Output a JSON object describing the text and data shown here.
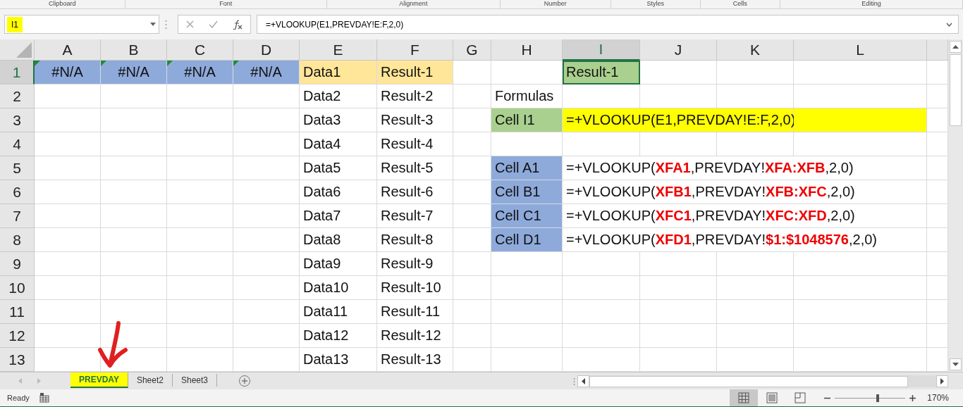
{
  "ribbon_groups": [
    "Clipboard",
    "Font",
    "Alignment",
    "Number",
    "Styles",
    "Cells",
    "Editing"
  ],
  "name_box": {
    "value": "I1",
    "highlighted": true
  },
  "formula_bar": {
    "value": "=+VLOOKUP(E1,PREVDAY!E:F,2,0)"
  },
  "columns": [
    {
      "label": "A",
      "selected": false
    },
    {
      "label": "B",
      "selected": false
    },
    {
      "label": "C",
      "selected": false
    },
    {
      "label": "D",
      "selected": false
    },
    {
      "label": "E",
      "selected": false
    },
    {
      "label": "F",
      "selected": false
    },
    {
      "label": "G",
      "selected": false
    },
    {
      "label": "H",
      "selected": false
    },
    {
      "label": "I",
      "selected": true
    },
    {
      "label": "J",
      "selected": false
    },
    {
      "label": "K",
      "selected": false
    },
    {
      "label": "L",
      "selected": false
    }
  ],
  "rows": [
    {
      "label": "1",
      "selected": true,
      "cells": [
        {
          "text": "#N/A",
          "color": "#8eaadb",
          "error_flag": true
        },
        {
          "text": "#N/A",
          "color": "#8eaadb",
          "error_flag": true
        },
        {
          "text": "#N/A",
          "color": "#8eaadb",
          "error_flag": true
        },
        {
          "text": "#N/A",
          "color": "#8eaadb",
          "error_flag": true
        },
        {
          "text": "Data1",
          "color": "#ffe699"
        },
        {
          "text": "Result-1",
          "color": "#ffe699"
        },
        {},
        {},
        {
          "text": "Result-1",
          "color": "#a9d08e",
          "selected": true
        }
      ]
    },
    {
      "label": "2",
      "selected": false,
      "cells": [
        {},
        {},
        {},
        {},
        {
          "text": "Data2"
        },
        {
          "text": "Result-2"
        },
        {},
        {
          "text": "Formulas"
        }
      ]
    },
    {
      "label": "3",
      "selected": false,
      "cells": [
        {},
        {},
        {},
        {},
        {
          "text": "Data3"
        },
        {
          "text": "Result-3"
        },
        {},
        {
          "text": "Cell I1",
          "color": "#a9d08e"
        },
        {
          "text": "=+VLOOKUP(E1,PREVDAY!E:F,2,0)",
          "color": "#ffff00"
        },
        {
          "color": "#ffff00"
        },
        {
          "color": "#ffff00"
        },
        {
          "color": "#ffff00"
        }
      ]
    },
    {
      "label": "4",
      "selected": false,
      "cells": [
        {},
        {},
        {},
        {},
        {
          "text": "Data4"
        },
        {
          "text": "Result-4"
        }
      ]
    },
    {
      "label": "5",
      "selected": false,
      "cells": [
        {},
        {},
        {},
        {},
        {
          "text": "Data5"
        },
        {
          "text": "Result-5"
        },
        {},
        {
          "text": "Cell A1",
          "color": "#8eaadb"
        },
        {
          "text": "=+VLOOKUP(**XFA1**,PREVDAY!**XFA:XFB**,2,0)"
        }
      ]
    },
    {
      "label": "6",
      "selected": false,
      "cells": [
        {},
        {},
        {},
        {},
        {
          "text": "Data6"
        },
        {
          "text": "Result-6"
        },
        {},
        {
          "text": "Cell B1",
          "color": "#8eaadb"
        },
        {
          "text": "=+VLOOKUP(**XFB1**,PREVDAY!**XFB:XFC**,2,0)"
        }
      ]
    },
    {
      "label": "7",
      "selected": false,
      "cells": [
        {},
        {},
        {},
        {},
        {
          "text": "Data7"
        },
        {
          "text": "Result-7"
        },
        {},
        {
          "text": "Cell C1",
          "color": "#8eaadb"
        },
        {
          "text": "=+VLOOKUP(**XFC1**,PREVDAY!**XFC:XFD**,2,0)"
        }
      ]
    },
    {
      "label": "8",
      "selected": false,
      "cells": [
        {},
        {},
        {},
        {},
        {
          "text": "Data8"
        },
        {
          "text": "Result-8"
        },
        {},
        {
          "text": "Cell D1",
          "color": "#8eaadb"
        },
        {
          "text": "=+VLOOKUP(**XFD1**,PREVDAY!**$1:$1048576**,2,0)"
        }
      ]
    },
    {
      "label": "9",
      "selected": false,
      "cells": [
        {},
        {},
        {},
        {},
        {
          "text": "Data9"
        },
        {
          "text": "Result-9"
        }
      ]
    },
    {
      "label": "10",
      "selected": false,
      "cells": [
        {},
        {},
        {},
        {},
        {
          "text": "Data10"
        },
        {
          "text": "Result-10"
        }
      ]
    },
    {
      "label": "11",
      "selected": false,
      "cells": [
        {},
        {},
        {},
        {},
        {
          "text": "Data11"
        },
        {
          "text": "Result-11"
        }
      ]
    },
    {
      "label": "12",
      "selected": false,
      "cells": [
        {},
        {},
        {},
        {},
        {
          "text": "Data12"
        },
        {
          "text": "Result-12"
        }
      ]
    },
    {
      "label": "13",
      "selected": false,
      "cells": [
        {},
        {},
        {},
        {},
        {
          "text": "Data13"
        },
        {
          "text": "Result-13"
        }
      ]
    }
  ],
  "sheet_tabs": [
    {
      "label": "PREVDAY",
      "selected": true,
      "highlighted": true
    },
    {
      "label": "Sheet2",
      "selected": false
    },
    {
      "label": "Sheet3",
      "selected": false
    }
  ],
  "status_bar": {
    "text": "Ready",
    "views": [
      {
        "kind": "normal",
        "selected": true
      },
      {
        "kind": "page-layout",
        "selected": false
      },
      {
        "kind": "page-break",
        "selected": false
      }
    ],
    "zoom": {
      "level": 0.61,
      "reading": "170%"
    }
  }
}
